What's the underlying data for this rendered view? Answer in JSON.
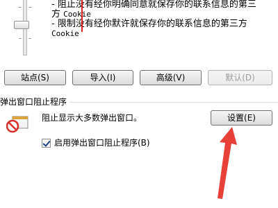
{
  "privacy": {
    "policy_line1": "- 阻止没有经你明确同意就保存你的联系信息的第三",
    "policy_line2a": "方 ",
    "policy_line2b": "Cookie",
    "policy_line3": "- 限制没有经你默许就保存你的联系信息的第三方",
    "policy_line4": "Cookie"
  },
  "buttons": {
    "sites": "站点(S)",
    "import": "导入(I)",
    "advanced": "高级(V)",
    "default": "默认(D)"
  },
  "popup_blocker": {
    "group_label": "弹出窗口阻止程序",
    "description": "阻止显示大多数弹出窗口。",
    "settings_button": "设置(E)",
    "enable_checkbox_label": "启用弹出窗口阻止程序(B)",
    "enable_checked": true
  },
  "colors": {
    "annotation_arrow": "#e8413a",
    "blocker_icon_red": "#d8322b",
    "caret": "#e02020"
  }
}
